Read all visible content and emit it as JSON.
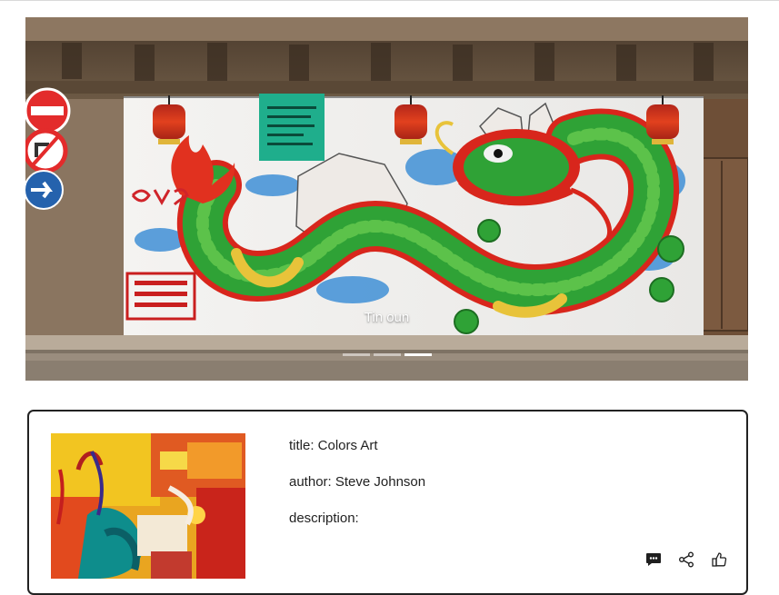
{
  "carousel": {
    "caption": "Tin oun",
    "slide_count": 3,
    "active_slide": 3
  },
  "card": {
    "title_line": "title: Colors Art",
    "author_line": "author: Steve Johnson",
    "description_line": "description:",
    "actions": [
      "comment-icon",
      "share-icon",
      "like-icon"
    ]
  },
  "colors": {
    "card_border": "#222222",
    "dragon_green": "#2fa236",
    "dragon_red": "#d8261c",
    "lantern_red": "#d93a1e"
  }
}
